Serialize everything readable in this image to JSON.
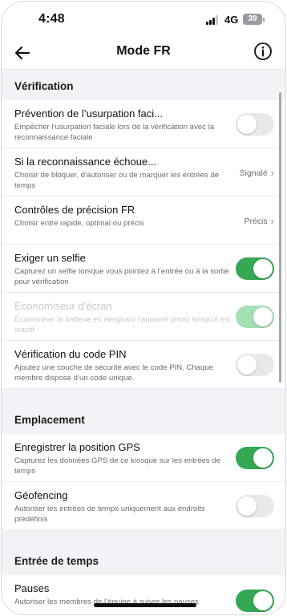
{
  "status_bar": {
    "time": "4:48",
    "network": "4G",
    "battery": "39",
    "battery_level": 0.39
  },
  "header": {
    "title": "Mode FR",
    "back_icon": "back-arrow-icon",
    "info_icon": "info-icon"
  },
  "sections": [
    {
      "title": "Vérification",
      "rows": [
        {
          "title": "Prévention de l’usurpation faci...",
          "desc": "Empêcher l’usurpation faciale lors de la vérification avec la reconnaissance faciale",
          "control": "toggle",
          "on": false
        },
        {
          "title": "Si la reconnaissance échoue...",
          "desc": "Choisir de bloquer, d'autoriser ou de marquer les entrées de temps",
          "control": "value",
          "value": "Signalé"
        },
        {
          "title": "Contrôles de précision FR",
          "desc": "Choisir entre rapide, optimal ou précis",
          "control": "value",
          "value": "Précis"
        },
        {
          "title": "Exiger un selfie",
          "desc": "Capturez un selfie lorsque vous pointez à l’entrée ou à la sortie pour vérification",
          "control": "toggle",
          "on": true
        },
        {
          "title": "Économiseur d'écran",
          "desc": "Économiser la batterie en éteignant l’appareil photo lorsqu’il est inactif",
          "control": "toggle",
          "on": true,
          "disabled": true
        },
        {
          "title": "Vérification du code PIN",
          "desc": "Ajoutez une couche de sécurité avec le code PIN. Chaque membre dispose d’un code unique.",
          "control": "toggle",
          "on": false
        }
      ]
    },
    {
      "title": "Emplacement",
      "rows": [
        {
          "title": "Enregistrer la position GPS",
          "desc": "Capturez les données GPS de ce kiosque sur les entrées de temps",
          "control": "toggle",
          "on": true
        },
        {
          "title": "Géofencing",
          "desc": "Autoriser les entrées de temps uniquement aux endroits prédéfinis",
          "control": "toggle",
          "on": false
        }
      ]
    },
    {
      "title": "Entrée de temps",
      "rows": [
        {
          "title": "Pauses",
          "desc": "Autoriser les membres de l’équipe à suivre les pauses",
          "control": "toggle",
          "on": true
        }
      ]
    }
  ],
  "colors": {
    "accent_green": "#34a853",
    "toggle_off": "#e9e9ec",
    "background": "#f2f2f7"
  }
}
